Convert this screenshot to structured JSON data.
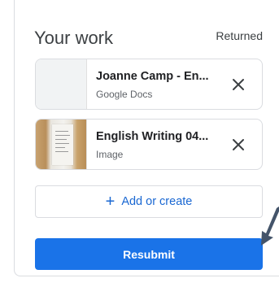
{
  "your_work": {
    "title": "Your work",
    "status": "Returned",
    "attachments": [
      {
        "title": "Joanne Camp - En...",
        "type": "Google Docs",
        "thumbnail": "blank-doc"
      },
      {
        "title": "English Writing 04...",
        "type": "Image",
        "thumbnail": "paper-photo"
      }
    ],
    "add_label": "Add or create",
    "submit_label": "Resubmit"
  },
  "colors": {
    "primary": "#1a73e8",
    "link": "#1967d2",
    "border": "#dadce0",
    "text": "#3c4043"
  },
  "icons": {
    "remove": "close-icon",
    "add": "plus-icon"
  }
}
